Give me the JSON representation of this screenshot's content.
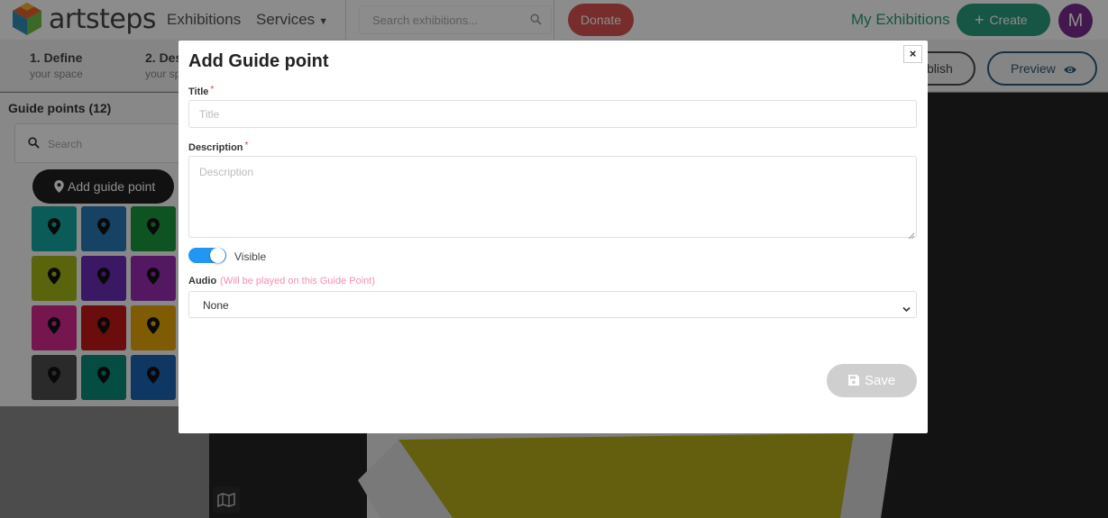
{
  "nav": {
    "logo_text": "artsteps",
    "exhibitions": "Exhibitions",
    "services": "Services",
    "search_placeholder": "Search exhibitions...",
    "donate": "Donate",
    "my_exhibitions": "My Exhibitions",
    "create": "Create",
    "avatar_letter": "M"
  },
  "steps": [
    {
      "title": "1. Define",
      "subtitle": "your space"
    },
    {
      "title": "2. Des",
      "subtitle": "your sp"
    }
  ],
  "actions": {
    "publish": "blish",
    "preview": "Preview"
  },
  "guide_panel": {
    "title": "Guide points (12)",
    "search_placeholder": "Search",
    "add_button": "Add guide point",
    "swatches": [
      "#14a8a0",
      "#2878b4",
      "#1a9a3e",
      "#a4b618",
      "#6a2cb4",
      "#9a2cb4",
      "#d8288e",
      "#c41818",
      "#e8a808",
      "#4e4e4e",
      "#0a8a78",
      "#1a64b4"
    ]
  },
  "modal": {
    "title": "Add Guide point",
    "close": "×",
    "title_label": "Title",
    "title_placeholder": "Title",
    "description_label": "Description",
    "description_placeholder": "Description",
    "required_mark": "*",
    "visible_label": "Visible",
    "visible_on": true,
    "audio_label": "Audio",
    "audio_note": "(Will be played on this Guide Point)",
    "audio_value": "None",
    "save": "Save"
  },
  "colors": {
    "accent": "#2a9d7d",
    "donate": "#d9534f",
    "avatar": "#7b2d8e",
    "toggle": "#2196f3",
    "preview": "#2c5a7a"
  }
}
